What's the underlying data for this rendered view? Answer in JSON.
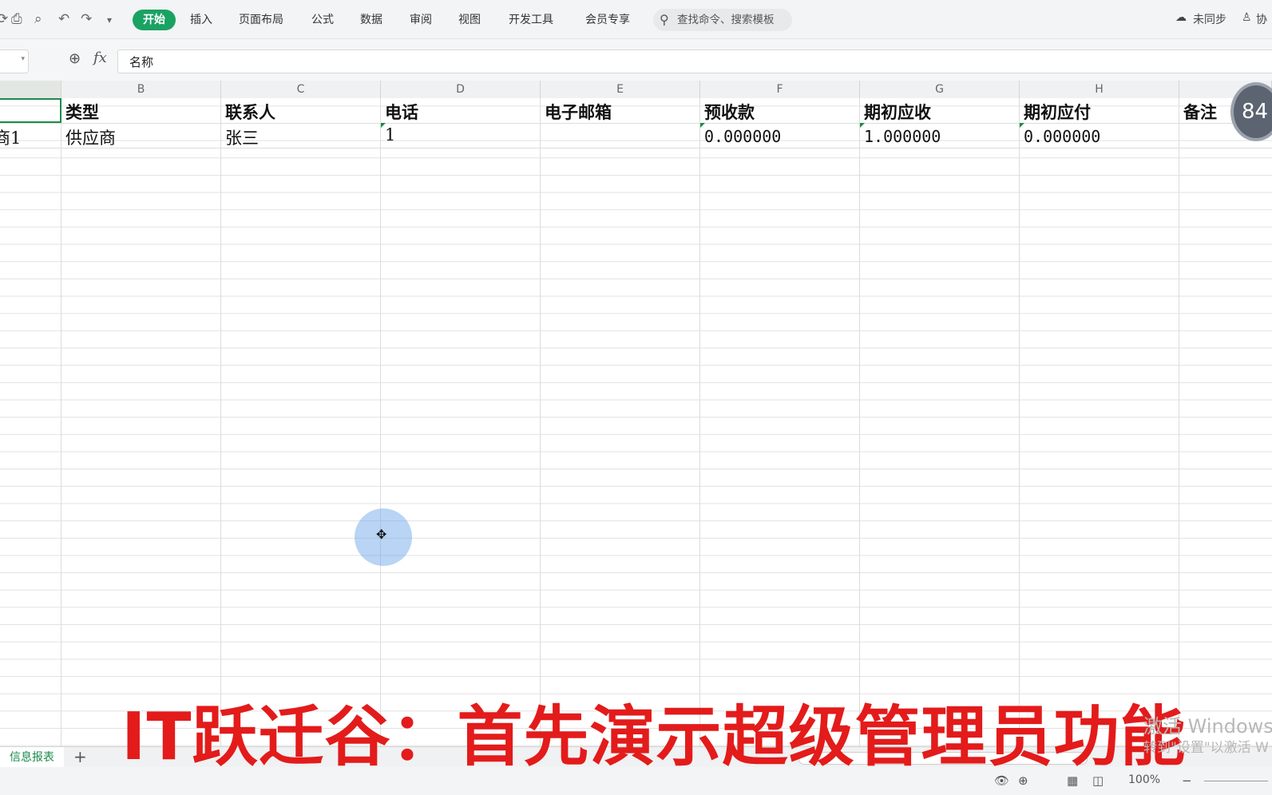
{
  "toolbar": {
    "tabs": [
      "开始",
      "插入",
      "页面布局",
      "公式",
      "数据",
      "审阅",
      "视图",
      "开发工具",
      "会员专享"
    ],
    "search_placeholder": "查找命令、搜索模板",
    "sync_label": "未同步",
    "collab_label": "协"
  },
  "formula_bar": {
    "fx": "fx",
    "content": "名称"
  },
  "columns": [
    "B",
    "C",
    "D",
    "E",
    "F",
    "G",
    "H"
  ],
  "headers": [
    "类型",
    "联系人",
    "电话",
    "电子邮箱",
    "预收款",
    "期初应收",
    "期初应付",
    "备注"
  ],
  "row1": {
    "a_partial": "商1",
    "type": "供应商",
    "contact": "张三",
    "phone": "1",
    "email": "",
    "prepaid": "0.000000",
    "ar": "1.000000",
    "ap": "0.000000"
  },
  "badge": "84",
  "sheet": {
    "name": "信息报表",
    "add": "+"
  },
  "status": {
    "zoom": "100%"
  },
  "caption": "IT跃迁谷：首先演示超级管理员功能",
  "watermark": {
    "line1": "激活 Windows",
    "line2": "转到\"设置\"以激活 W"
  }
}
